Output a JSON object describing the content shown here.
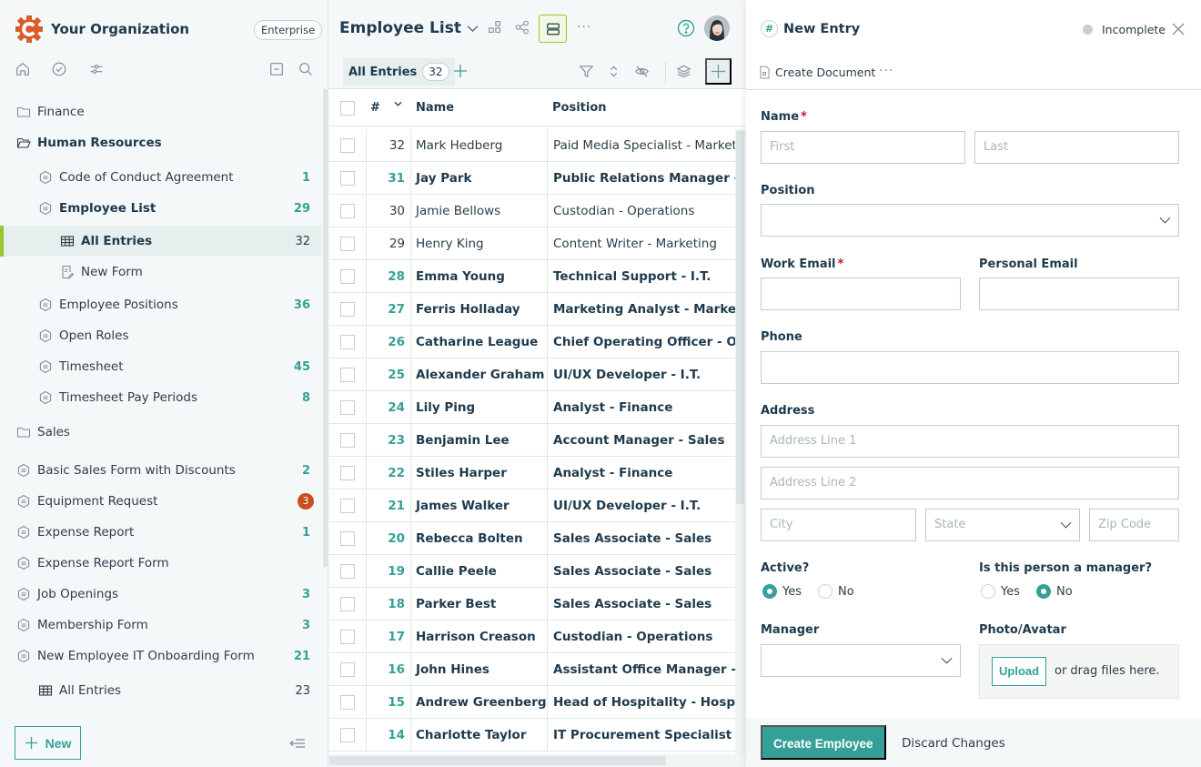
{
  "sidebar": {
    "org_name": "Your Organization",
    "plan": "Enterprise",
    "tools": [
      "home-icon",
      "check-circle-icon",
      "filter-sliders-icon",
      "collapse-all-icon",
      "search-icon"
    ],
    "items": [
      {
        "label": "Finance",
        "type": "folder",
        "count": ""
      },
      {
        "label": "Human Resources",
        "type": "folder-open",
        "count": ""
      },
      {
        "label": "Code of Conduct Agreement",
        "type": "form",
        "count": "1"
      },
      {
        "label": "Employee List",
        "type": "form",
        "count": "29"
      },
      {
        "label": "All Entries",
        "type": "view",
        "count": "32"
      },
      {
        "label": "New Form",
        "type": "new-form",
        "count": ""
      },
      {
        "label": "Employee Positions",
        "type": "form",
        "count": "36"
      },
      {
        "label": "Open Roles",
        "type": "form",
        "count": ""
      },
      {
        "label": "Timesheet",
        "type": "form",
        "count": "45"
      },
      {
        "label": "Timesheet Pay Periods",
        "type": "form",
        "count": "8"
      },
      {
        "label": "Sales",
        "type": "folder",
        "count": ""
      },
      {
        "label": "Basic Sales Form with Discounts",
        "type": "form",
        "count": "2"
      },
      {
        "label": "Equipment Request",
        "type": "form",
        "count": "3",
        "alert": true
      },
      {
        "label": "Expense Report",
        "type": "form",
        "count": "1"
      },
      {
        "label": "Expense Report Form",
        "type": "form",
        "count": ""
      },
      {
        "label": "Job Openings",
        "type": "form",
        "count": "3"
      },
      {
        "label": "Membership Form",
        "type": "form",
        "count": "3"
      },
      {
        "label": "New Employee IT Onboarding Form",
        "type": "form",
        "count": "21"
      },
      {
        "label": "All Entries",
        "type": "view",
        "count": "23"
      }
    ],
    "new_label": "New"
  },
  "main": {
    "title": "Employee List",
    "tab": {
      "label": "All Entries",
      "count": "32"
    },
    "columns": {
      "num": "#",
      "name": "Name",
      "position": "Position"
    },
    "rows": [
      {
        "num": "32",
        "name": "Mark Hedberg",
        "position": "Paid Media Specialist - Marketing",
        "unread": false
      },
      {
        "num": "31",
        "name": "Jay Park",
        "position": "Public Relations Manager - Marketing",
        "unread": true
      },
      {
        "num": "30",
        "name": "Jamie Bellows",
        "position": "Custodian - Operations",
        "unread": false
      },
      {
        "num": "29",
        "name": "Henry King",
        "position": "Content Writer - Marketing",
        "unread": false
      },
      {
        "num": "28",
        "name": "Emma Young",
        "position": "Technical Support - I.T.",
        "unread": true
      },
      {
        "num": "27",
        "name": "Ferris Holladay",
        "position": "Marketing Analyst - Marketing",
        "unread": true
      },
      {
        "num": "26",
        "name": "Catharine League",
        "position": "Chief Operating Officer - Operations",
        "unread": true
      },
      {
        "num": "25",
        "name": "Alexander Graham",
        "position": "UI/UX Developer - I.T.",
        "unread": true
      },
      {
        "num": "24",
        "name": "Lily Ping",
        "position": "Analyst - Finance",
        "unread": true
      },
      {
        "num": "23",
        "name": "Benjamin Lee",
        "position": "Account Manager - Sales",
        "unread": true
      },
      {
        "num": "22",
        "name": "Stiles Harper",
        "position": "Analyst - Finance",
        "unread": true
      },
      {
        "num": "21",
        "name": "James Walker",
        "position": "UI/UX Developer - I.T.",
        "unread": true
      },
      {
        "num": "20",
        "name": "Rebecca Bolten",
        "position": "Sales Associate - Sales",
        "unread": true
      },
      {
        "num": "19",
        "name": "Callie Peele",
        "position": "Sales Associate - Sales",
        "unread": true
      },
      {
        "num": "18",
        "name": "Parker Best",
        "position": "Sales Associate - Sales",
        "unread": true
      },
      {
        "num": "17",
        "name": "Harrison Creason",
        "position": "Custodian - Operations",
        "unread": true
      },
      {
        "num": "16",
        "name": "John Hines",
        "position": "Assistant Office Manager - Operations",
        "unread": true
      },
      {
        "num": "15",
        "name": "Andrew Greenberg",
        "position": "Head of Hospitality - Hospitality",
        "unread": true
      },
      {
        "num": "14",
        "name": "Charlotte Taylor",
        "position": "IT Procurement Specialist - I.T.",
        "unread": true
      }
    ]
  },
  "panel": {
    "title": "New Entry",
    "status": "Incomplete",
    "create_document": "Create Document",
    "fields": {
      "name_label": "Name",
      "first_placeholder": "First",
      "last_placeholder": "Last",
      "position_label": "Position",
      "work_email_label": "Work Email",
      "personal_email_label": "Personal Email",
      "phone_label": "Phone",
      "address_label": "Address",
      "address1_placeholder": "Address Line 1",
      "address2_placeholder": "Address Line 2",
      "city_placeholder": "City",
      "state_placeholder": "State",
      "zip_placeholder": "Zip Code",
      "active_label": "Active?",
      "active_value": "Yes",
      "manager_q_label": "Is this person a manager?",
      "manager_q_value": "No",
      "yes": "Yes",
      "no": "No",
      "manager_label": "Manager",
      "photo_label": "Photo/Avatar",
      "upload_label": "Upload",
      "upload_hint": "or drag files here."
    },
    "required_mark": "*",
    "submit_label": "Create Employee",
    "discard_label": "Discard Changes"
  },
  "colors": {
    "accent": "#35a097",
    "selection": "#9ac72f",
    "alert": "#c94f1f",
    "brand": "#d95b27"
  }
}
